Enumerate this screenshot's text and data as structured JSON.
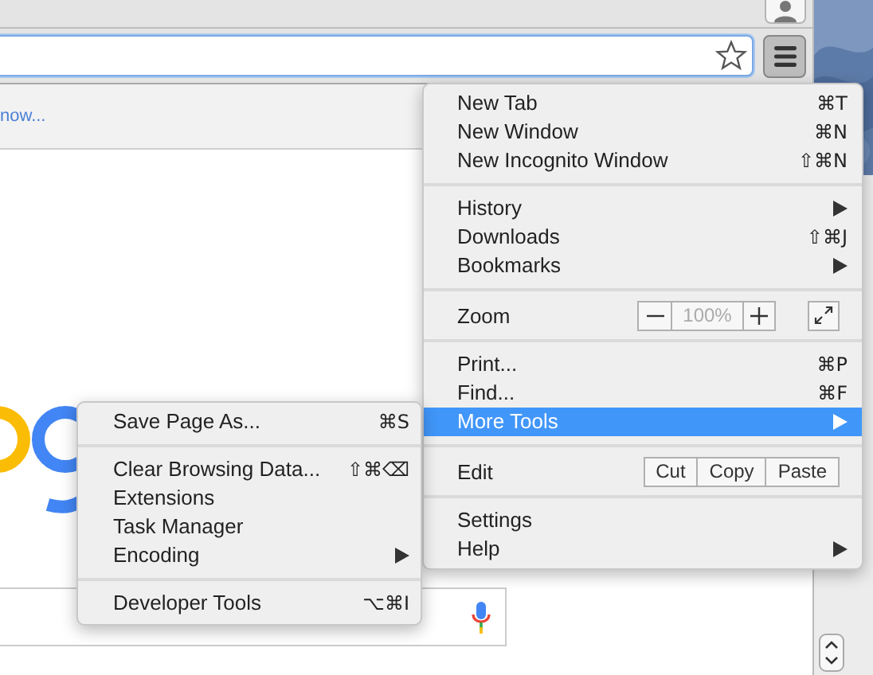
{
  "browser": {
    "infobar": {
      "link": "now..."
    }
  },
  "main_menu": {
    "items": [
      {
        "kind": "item",
        "label": "New Tab",
        "shortcut": "⌘T",
        "has_submenu": false,
        "selected": false
      },
      {
        "kind": "item",
        "label": "New Window",
        "shortcut": "⌘N",
        "has_submenu": false,
        "selected": false
      },
      {
        "kind": "item",
        "label": "New Incognito Window",
        "shortcut": "⇧⌘N",
        "has_submenu": false,
        "selected": false
      },
      {
        "kind": "separator"
      },
      {
        "kind": "item",
        "label": "History",
        "has_submenu": true,
        "selected": false
      },
      {
        "kind": "item",
        "label": "Downloads",
        "shortcut": "⇧⌘J",
        "has_submenu": false,
        "selected": false
      },
      {
        "kind": "item",
        "label": "Bookmarks",
        "has_submenu": true,
        "selected": false
      },
      {
        "kind": "separator"
      },
      {
        "kind": "zoom",
        "label": "Zoom",
        "value": "100%"
      },
      {
        "kind": "separator"
      },
      {
        "kind": "item",
        "label": "Print...",
        "shortcut": "⌘P",
        "has_submenu": false,
        "selected": false
      },
      {
        "kind": "item",
        "label": "Find...",
        "shortcut": "⌘F",
        "has_submenu": false,
        "selected": false
      },
      {
        "kind": "item",
        "label": "More Tools",
        "has_submenu": true,
        "selected": true
      },
      {
        "kind": "separator"
      },
      {
        "kind": "edit",
        "label": "Edit",
        "buttons": [
          "Cut",
          "Copy",
          "Paste"
        ]
      },
      {
        "kind": "separator"
      },
      {
        "kind": "item",
        "label": "Settings",
        "has_submenu": false,
        "selected": false
      },
      {
        "kind": "item",
        "label": "Help",
        "has_submenu": true,
        "selected": false
      }
    ]
  },
  "submenu": {
    "items": [
      {
        "kind": "item",
        "label": "Save Page As...",
        "shortcut": "⌘S",
        "has_submenu": false,
        "selected": false
      },
      {
        "kind": "separator"
      },
      {
        "kind": "item",
        "label": "Clear Browsing Data...",
        "shortcut": "⇧⌘⌫",
        "has_submenu": false,
        "selected": false
      },
      {
        "kind": "item",
        "label": "Extensions",
        "has_submenu": false,
        "selected": false
      },
      {
        "kind": "item",
        "label": "Task Manager",
        "has_submenu": false,
        "selected": false
      },
      {
        "kind": "item",
        "label": "Encoding",
        "has_submenu": true,
        "selected": false
      },
      {
        "kind": "separator"
      },
      {
        "kind": "item",
        "label": "Developer Tools",
        "shortcut": "⌥⌘I",
        "has_submenu": false,
        "selected": false
      }
    ]
  }
}
